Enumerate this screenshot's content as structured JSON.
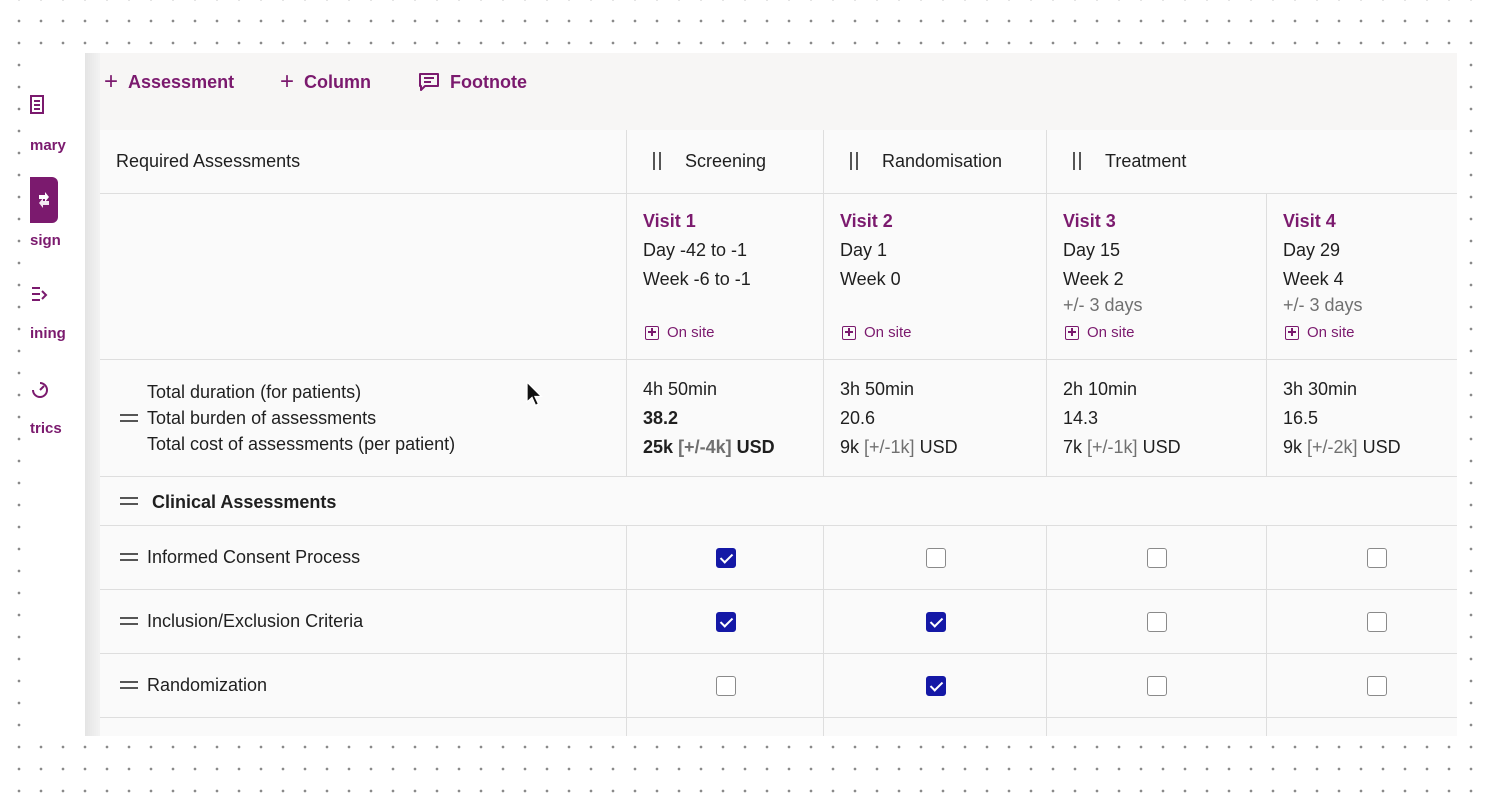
{
  "sidebar": {
    "items": [
      {
        "label": "mary",
        "icon": "document-icon"
      },
      {
        "label": "sign",
        "icon": "design-icon",
        "active": true
      },
      {
        "label": "ining",
        "icon": "planning-icon"
      },
      {
        "label": "trics",
        "icon": "metrics-icon"
      }
    ]
  },
  "toolbar": {
    "add_assessment": "Assessment",
    "add_column": "Column",
    "footnote": "Footnote"
  },
  "table": {
    "header_label": "Required Assessments",
    "phases": [
      "Screening",
      "Randomisation",
      "Treatment"
    ],
    "visits": [
      {
        "title": "Visit 1",
        "day": "Day -42 to -1",
        "week": "Week -6 to -1",
        "window": "",
        "location": "On site"
      },
      {
        "title": "Visit 2",
        "day": "Day 1",
        "week": "Week 0",
        "window": "",
        "location": "On site"
      },
      {
        "title": "Visit 3",
        "day": "Day 15",
        "week": "Week 2",
        "window": "+/- 3 days",
        "location": "On site"
      },
      {
        "title": "Visit 4",
        "day": "Day 29",
        "week": "Week 4",
        "window": "+/- 3 days",
        "location": "On site"
      }
    ],
    "totals_labels": {
      "duration": "Total duration (for patients)",
      "burden": "Total burden of assessments",
      "cost": "Total cost of assessments (per patient)"
    },
    "totals": [
      {
        "duration": "4h 50min",
        "burden": "38.2",
        "cost": "25k",
        "range": "[+/-4k]",
        "currency": "USD"
      },
      {
        "duration": "3h 50min",
        "burden": "20.6",
        "cost": "9k",
        "range": "[+/-1k]",
        "currency": "USD"
      },
      {
        "duration": "2h 10min",
        "burden": "14.3",
        "cost": "7k",
        "range": "[+/-1k]",
        "currency": "USD"
      },
      {
        "duration": "3h 30min",
        "burden": "16.5",
        "cost": "9k",
        "range": "[+/-2k]",
        "currency": "USD"
      }
    ],
    "section_title": "Clinical Assessments",
    "assessments": [
      {
        "name": "Informed Consent Process",
        "checks": [
          true,
          false,
          false,
          false
        ]
      },
      {
        "name": "Inclusion/Exclusion Criteria",
        "checks": [
          true,
          true,
          false,
          false
        ]
      },
      {
        "name": "Randomization",
        "checks": [
          false,
          true,
          false,
          false
        ]
      }
    ]
  },
  "colors": {
    "accent": "#7b1a6e",
    "checkbox_checked": "#1418a6"
  }
}
